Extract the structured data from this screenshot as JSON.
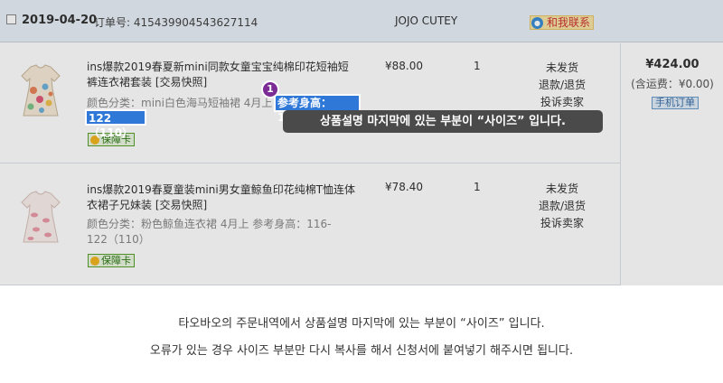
{
  "header": {
    "date": "2019-04-20",
    "order_number": "订单号: 415439904543627114",
    "shop_name": "JOJO CUTEY",
    "contact_label": "和我联系"
  },
  "items": [
    {
      "title": "ins爆款2019春夏新mini同款女童宝宝纯棉印花短袖短裤连衣裙套装 [交易快照]",
      "attrs_color": "颜色分类：mini白色海马短袖裙 4月上",
      "attrs_size_part1": "参考身高：116-",
      "attrs_size_part2": "122（110）",
      "warranty": "保障卡",
      "price": "¥88.00",
      "qty": "1",
      "status": [
        "未发货",
        "退款/退货",
        "投诉卖家"
      ]
    },
    {
      "title": "ins爆款2019春夏童装mini男女童鲸鱼印花纯棉T恤连体衣裙子兄妹装 [交易快照]",
      "attrs": "颜色分类：粉色鲸鱼连衣裙 4月上 参考身高：116-122（110）",
      "warranty": "保障卡",
      "price": "¥78.40",
      "qty": "1",
      "status": [
        "未发货",
        "退款/退货",
        "投诉卖家"
      ]
    }
  ],
  "summary": {
    "total": "¥424.00",
    "shipping": "(含运费：¥0.00)",
    "mobile_order": "手机订单"
  },
  "annotation": {
    "badge": "1",
    "tooltip": "상품설명 마지막에 있는 부분이 “사이즈” 입니다."
  },
  "caption": {
    "line1": "타오바오의 주문내역에서 상품설명 마지막에 있는 부분이 “사이즈” 입니다.",
    "line2": "오류가 있는 경우 사이즈 부분만 다시 복사를 해서 신청서에 붙여넣기 해주시면 됩니다."
  },
  "colors": {
    "highlight": "#2f78d8",
    "badge": "#7b2c95",
    "tooltip_bg": "#4a4a4a"
  }
}
